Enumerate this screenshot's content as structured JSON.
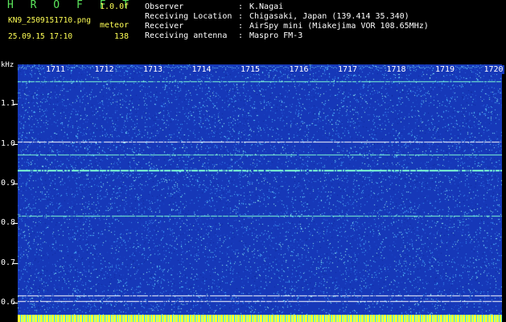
{
  "header": {
    "app_title": "H R O F F T",
    "app_version": "1.0.0f",
    "file_name": "KN9_2509151710.png",
    "mode": "meteor",
    "datetime": "25.09.15 17:10",
    "count": "138",
    "meta": [
      {
        "key": "Observer",
        "value": "K.Nagai"
      },
      {
        "key": "Receiving Location",
        "value": "Chigasaki, Japan (139.414 35.340)"
      },
      {
        "key": "Receiver",
        "value": "AirSpy mini (Miakejima VOR 108.65MHz)"
      },
      {
        "key": "Receiving antenna",
        "value": "Maspro FM-3"
      }
    ],
    "separator": ":"
  },
  "spectrogram": {
    "y_unit": "kHz",
    "y_ticks": [
      "1.1",
      "1.0",
      "0.9",
      "0.8",
      "0.7",
      "0.6"
    ],
    "y_range": [
      0.57,
      1.2
    ],
    "time_labels": [
      "1711",
      "1712",
      "1713",
      "1714",
      "1715",
      "1716",
      "1717",
      "1718",
      "1719",
      "1720"
    ],
    "horizontal_lines_khz": [
      1.157,
      1.005,
      0.973,
      0.935,
      0.82,
      0.618,
      0.605
    ],
    "colors": {
      "background": "#1638b8",
      "noise_dot": "#3fa0ff",
      "line": "#7fffd4",
      "bright_line": "#ffffff"
    }
  }
}
